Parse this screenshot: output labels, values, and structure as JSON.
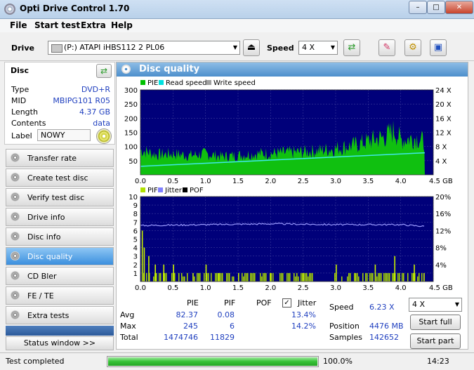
{
  "window": {
    "title": "Opti Drive Control 1.70"
  },
  "menu": [
    "File",
    "Start test",
    "Extra",
    "Help"
  ],
  "toolbar": {
    "drive_label": "Drive",
    "drive_value": "(P:)  ATAPI iHBS112  2 PL06",
    "speed_label": "Speed",
    "speed_value": "4 X"
  },
  "disc": {
    "header": "Disc",
    "type_label": "Type",
    "type_value": "DVD+R",
    "mid_label": "MID",
    "mid_value": "MBIPG101 R05",
    "length_label": "Length",
    "length_value": "4.37 GB",
    "contents_label": "Contents",
    "contents_value": "data",
    "label_label": "Label",
    "label_value": "NOWY"
  },
  "nav": [
    "Transfer rate",
    "Create test disc",
    "Verify test disc",
    "Drive info",
    "Disc info",
    "Disc quality",
    "CD Bler",
    "FE / TE",
    "Extra tests"
  ],
  "nav_active": "Disc quality",
  "status_window_button": "Status window >>",
  "panel_title": "Disc quality",
  "chart_data": [
    {
      "type": "area",
      "legend": [
        "PIE",
        "Read speed",
        "Write speed"
      ],
      "colors": {
        "PIE": "#00c000",
        "Read speed": "#00e0e0",
        "Write speed": "#a0a0a0"
      },
      "x_ticks": [
        "0.0",
        "0.5",
        "1.0",
        "1.5",
        "2.0",
        "2.5",
        "3.0",
        "3.5",
        "4.0",
        "4.5 GB"
      ],
      "xlim": [
        0,
        4.5
      ],
      "y_ticks": [
        "300",
        "250",
        "200",
        "150",
        "100",
        "50"
      ],
      "ylim": [
        0,
        300
      ],
      "y2_ticks": [
        "24 X",
        "20 X",
        "16 X",
        "12 X",
        "8 X",
        "4 X"
      ],
      "y2lim": [
        0,
        24
      ],
      "series": [
        {
          "name": "PIE",
          "x": [
            0.0,
            0.25,
            0.5,
            0.75,
            1.0,
            1.25,
            1.5,
            1.75,
            2.0,
            2.25,
            2.5,
            2.75,
            3.0,
            3.25,
            3.5,
            3.75,
            3.9,
            4.0,
            4.25,
            4.37
          ],
          "values": [
            92,
            75,
            78,
            72,
            78,
            68,
            72,
            78,
            80,
            82,
            85,
            90,
            98,
            108,
            125,
            140,
            165,
            130,
            138,
            120
          ]
        },
        {
          "name": "Read speed",
          "x": [
            0.0,
            4.37
          ],
          "values": [
            2.4,
            6.23
          ]
        }
      ]
    },
    {
      "type": "bar",
      "legend": [
        "PIF",
        "Jitter",
        "POF"
      ],
      "colors": {
        "PIF": "#b0e000",
        "Jitter": "#8080ff",
        "POF": "#000000"
      },
      "x_ticks": [
        "0.0",
        "0.5",
        "1.0",
        "1.5",
        "2.0",
        "2.5",
        "3.0",
        "3.5",
        "4.0",
        "4.5 GB"
      ],
      "xlim": [
        0,
        4.5
      ],
      "y_ticks": [
        "10",
        "9",
        "8",
        "7",
        "6",
        "5",
        "4",
        "3",
        "2",
        "1"
      ],
      "ylim": [
        0,
        10
      ],
      "y2_ticks": [
        "20%",
        "16%",
        "12%",
        "8%",
        "4%"
      ],
      "y2lim": [
        0,
        20
      ],
      "series": [
        {
          "name": "PIF",
          "x": [
            0.02,
            0.05,
            0.12,
            0.22,
            0.35,
            0.5,
            0.8,
            1.0,
            1.2,
            1.5,
            2.0,
            2.5,
            3.0,
            3.3,
            3.6,
            3.9,
            4.2,
            4.35
          ],
          "values": [
            6,
            4,
            3,
            2,
            2,
            2,
            1,
            2,
            1,
            1,
            1,
            1,
            2,
            1,
            2,
            3,
            2,
            1
          ]
        },
        {
          "name": "Jitter",
          "x": [
            0.0,
            1.0,
            2.0,
            3.0,
            4.0,
            4.37
          ],
          "values": [
            13.2,
            13.4,
            13.6,
            13.4,
            13.4,
            13.0
          ]
        }
      ]
    }
  ],
  "stats": {
    "pie_header": "PIE",
    "pif_header": "PIF",
    "pof_header": "POF",
    "jitter_header": "Jitter",
    "avg_label": "Avg",
    "avg_pie": "82.37",
    "avg_pif": "0.08",
    "avg_jitter": "13.4%",
    "max_label": "Max",
    "max_pie": "245",
    "max_pif": "6",
    "max_jitter": "14.2%",
    "total_label": "Total",
    "total_pie": "1474746",
    "total_pif": "11829",
    "speed_label": "Speed",
    "speed_value": "6.23 X",
    "position_label": "Position",
    "position_value": "4476 MB",
    "samples_label": "Samples",
    "samples_value": "142652",
    "speed_select": "4 X",
    "start_full": "Start full",
    "start_part": "Start part"
  },
  "status": {
    "text": "Test completed",
    "progress_percent": "100.0%",
    "progress_fraction": 1.0,
    "time": "14:23"
  }
}
